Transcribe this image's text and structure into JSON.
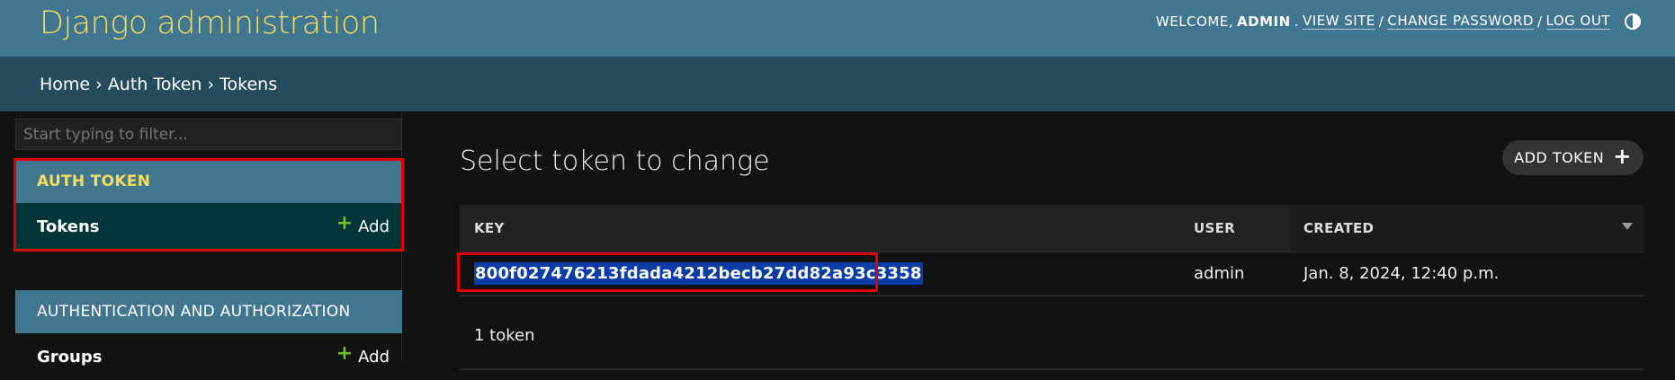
{
  "header": {
    "title": "Django administration",
    "welcome": "WELCOME,",
    "username": "ADMIN",
    "view_site": "VIEW SITE",
    "change_password": "CHANGE PASSWORD",
    "log_out": "LOG OUT",
    "sep": "/"
  },
  "breadcrumbs": [
    "Home",
    "Auth Token",
    "Tokens"
  ],
  "breadcrumb_sep": "›",
  "sidebar": {
    "filter_placeholder": "Start typing to filter...",
    "apps": [
      {
        "caption": "AUTH TOKEN",
        "models": [
          {
            "name": "Tokens",
            "add": "Add"
          }
        ]
      },
      {
        "caption": "AUTHENTICATION AND AUTHORIZATION",
        "models": [
          {
            "name": "Groups",
            "add": "Add"
          }
        ]
      }
    ]
  },
  "main": {
    "title": "Select token to change",
    "add_button": "ADD TOKEN",
    "columns": [
      "KEY",
      "USER",
      "CREATED"
    ],
    "rows": [
      {
        "key": "800f027476213fdada4212becb27dd82a93c3358",
        "user": "admin",
        "created": "Jan. 8, 2024, 12:40 p.m."
      }
    ],
    "count": "1 token"
  },
  "colors": {
    "header": "#417690",
    "breadcrumbs": "#264b5d",
    "branding": "#f5dd5d",
    "highlight": "#e00000"
  }
}
